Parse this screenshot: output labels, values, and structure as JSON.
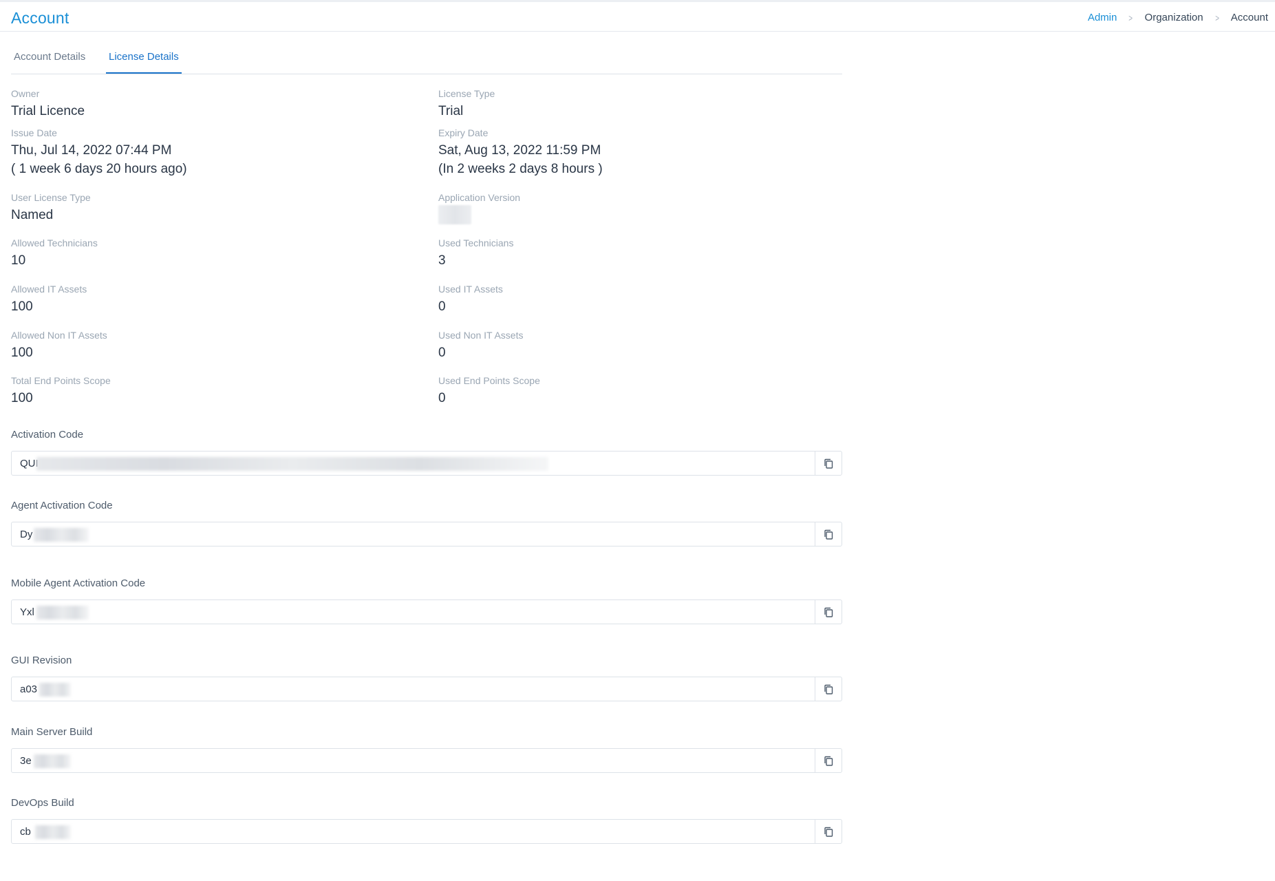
{
  "header": {
    "title": "Account",
    "breadcrumb": [
      "Admin",
      "Organization",
      "Account"
    ]
  },
  "tabs": [
    {
      "label": "Account Details",
      "active": false
    },
    {
      "label": "License Details",
      "active": true
    }
  ],
  "fields": {
    "owner": {
      "label": "Owner",
      "value": "Trial Licence"
    },
    "license_type": {
      "label": "License Type",
      "value": "Trial"
    },
    "issue_date": {
      "label": "Issue Date",
      "value": "Thu, Jul 14, 2022 07:44 PM",
      "relative": "( 1 week 6 days 20 hours ago)"
    },
    "expiry_date": {
      "label": "Expiry Date",
      "value": "Sat, Aug 13, 2022 11:59 PM",
      "relative": "(In 2 weeks 2 days 8 hours )"
    },
    "user_license_type": {
      "label": "User License Type",
      "value": "Named"
    },
    "application_version": {
      "label": "Application Version",
      "value": ""
    },
    "allowed_technicians": {
      "label": "Allowed Technicians",
      "value": "10"
    },
    "used_technicians": {
      "label": "Used Technicians",
      "value": "3"
    },
    "allowed_it_assets": {
      "label": "Allowed IT Assets",
      "value": "100"
    },
    "used_it_assets": {
      "label": "Used IT Assets",
      "value": "0"
    },
    "allowed_non_it_assets": {
      "label": "Allowed Non IT Assets",
      "value": "100"
    },
    "used_non_it_assets": {
      "label": "Used Non IT Assets",
      "value": "0"
    },
    "total_end_points_scope": {
      "label": "Total End Points Scope",
      "value": "100"
    },
    "used_end_points_scope": {
      "label": "Used End Points Scope",
      "value": "0"
    }
  },
  "codes": [
    {
      "label": "Activation Code",
      "value": "QUI"
    },
    {
      "label": "Agent Activation Code",
      "value": "Dy"
    },
    {
      "label": "Mobile Agent Activation Code",
      "value": "Yxl"
    },
    {
      "label": "GUI Revision",
      "value": "a03"
    },
    {
      "label": "Main Server Build",
      "value": "3e"
    },
    {
      "label": "DevOps Build",
      "value": "cb"
    }
  ],
  "icons": {
    "copy": "copy-icon",
    "separator": "chevron-right-icon"
  },
  "colors": {
    "accent": "#1a8fd6",
    "tab_active": "#1a73c9",
    "label": "#9aa6b3",
    "value": "#2a3646"
  }
}
